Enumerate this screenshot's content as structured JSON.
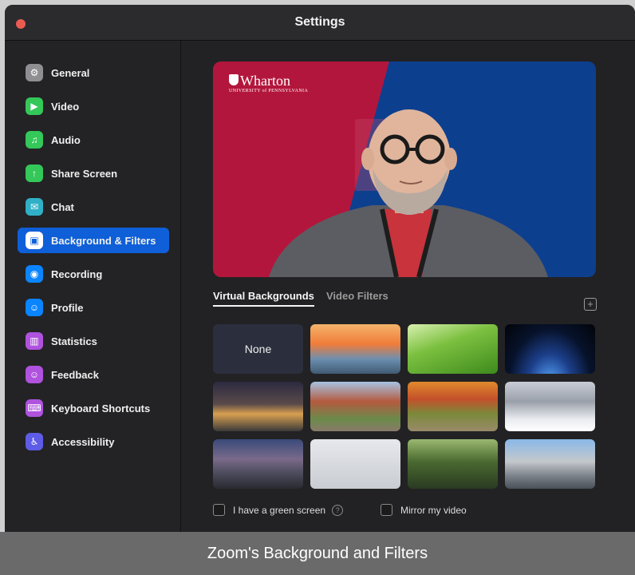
{
  "window": {
    "title": "Settings"
  },
  "sidebar": {
    "items": [
      {
        "label": "General",
        "icon": "gear-icon",
        "color": "#8e8e93",
        "glyph": "⚙",
        "active": false
      },
      {
        "label": "Video",
        "icon": "video-camera-icon",
        "color": "#34c759",
        "glyph": "▶",
        "active": false
      },
      {
        "label": "Audio",
        "icon": "headphones-icon",
        "color": "#34c759",
        "glyph": "♫",
        "active": false
      },
      {
        "label": "Share Screen",
        "icon": "share-screen-icon",
        "color": "#34c759",
        "glyph": "↑",
        "active": false
      },
      {
        "label": "Chat",
        "icon": "chat-bubble-icon",
        "color": "#30b0c7",
        "glyph": "✉",
        "active": false
      },
      {
        "label": "Background & Filters",
        "icon": "background-icon",
        "color": "#0e5fd8",
        "glyph": "▣",
        "active": true
      },
      {
        "label": "Recording",
        "icon": "record-icon",
        "color": "#0a84ff",
        "glyph": "◉",
        "active": false
      },
      {
        "label": "Profile",
        "icon": "profile-icon",
        "color": "#0a84ff",
        "glyph": "☺",
        "active": false
      },
      {
        "label": "Statistics",
        "icon": "statistics-icon",
        "color": "#af52de",
        "glyph": "▥",
        "active": false
      },
      {
        "label": "Feedback",
        "icon": "feedback-icon",
        "color": "#af52de",
        "glyph": "☺",
        "active": false
      },
      {
        "label": "Keyboard Shortcuts",
        "icon": "keyboard-icon",
        "color": "#af52de",
        "glyph": "⌨",
        "active": false
      },
      {
        "label": "Accessibility",
        "icon": "accessibility-icon",
        "color": "#5e5ce6",
        "glyph": "♿",
        "active": false
      }
    ]
  },
  "preview": {
    "logo": "Wharton",
    "logo_sub": "UNIVERSITY of PENNSYLVANIA"
  },
  "tabs": {
    "virtual_backgrounds": "Virtual Backgrounds",
    "video_filters": "Video Filters"
  },
  "backgrounds": {
    "none_label": "None",
    "items": [
      {
        "name": "golden-gate-bridge",
        "bg": "linear-gradient(180deg,#f4b36a 0%,#f07c3a 40%,#6c8fb0 70%,#405a72 100%)"
      },
      {
        "name": "green-grass",
        "bg": "linear-gradient(160deg,#d8f0b0 0%,#7cc040 40%,#3d8a1c 100%)"
      },
      {
        "name": "earth-from-space",
        "bg": "radial-gradient(ellipse at 50% 120%,#5aa8ff 0%,#1c3f8a 35%,#07122b 65%,#020409 100%)"
      },
      {
        "name": "campus-night-lights",
        "bg": "linear-gradient(180deg,#2c2a40 0%,#5a4a4a 45%,#d8a050 65%,#3a3a3a 100%)"
      },
      {
        "name": "campus-brick-building",
        "bg": "linear-gradient(180deg,#a7c3e3 0%,#b45a3f 40%,#6a8a4a 75%,#8a7a6a 100%)"
      },
      {
        "name": "autumn-trees",
        "bg": "linear-gradient(180deg,#e08a2c 0%,#c4502a 35%,#7a8a3a 65%,#9a8a6a 100%)"
      },
      {
        "name": "snowy-campus",
        "bg": "linear-gradient(180deg,#c8ccd6 0%,#9aa0aa 40%,#e8eaee 75%,#ffffff 100%)"
      },
      {
        "name": "city-skyline-dusk",
        "bg": "linear-gradient(180deg,#3a4a7a 0%,#7a6a8a 40%,#4a4a5a 70%,#2a2a30 100%)"
      },
      {
        "name": "plain-gray-logo",
        "bg": "linear-gradient(180deg,#e6e8ec 0%,#c9ccd2 100%)"
      },
      {
        "name": "statue-in-park",
        "bg": "linear-gradient(180deg,#9ab870 0%,#4a6a30 45%,#2a3a22 100%)"
      },
      {
        "name": "city-aerial-view",
        "bg": "linear-gradient(180deg,#8ab8e8 0%,#c4c8cc 45%,#7a8088 75%,#4a5058 100%)"
      }
    ]
  },
  "options": {
    "green_screen": "I have a green screen",
    "help_glyph": "?",
    "mirror": "Mirror my video"
  },
  "add_button": "+",
  "caption": "Zoom's Background and Filters"
}
